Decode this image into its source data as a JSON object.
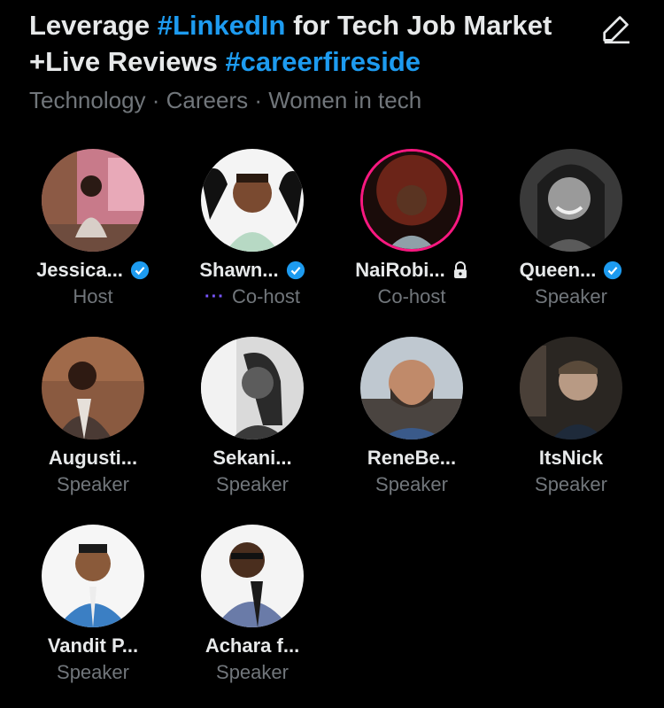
{
  "space": {
    "title_parts": [
      {
        "text": "Leverage ",
        "type": "text"
      },
      {
        "text": "#LinkedIn",
        "type": "hashtag"
      },
      {
        "text": " for Tech Job Market +Live Reviews ",
        "type": "text"
      },
      {
        "text": "#careerfireside",
        "type": "hashtag"
      }
    ],
    "topics": "Technology · Careers · Women in tech",
    "edit_icon": "pencil-icon"
  },
  "colors": {
    "background": "#000000",
    "primary_text": "#E7E9EA",
    "secondary_text": "#71767B",
    "hashtag": "#1D9BF0",
    "verified": "#1D9BF0",
    "live_ring": "#F91880",
    "speaking_dots": "#7856FF"
  },
  "participants": [
    {
      "name": "Jessica...",
      "role": "Host",
      "verified": true,
      "locked": false,
      "speaking": false
    },
    {
      "name": "Shawn...",
      "role": "Co-host",
      "verified": true,
      "locked": false,
      "speaking": true
    },
    {
      "name": "NaiRobi...",
      "role": "Co-host",
      "verified": false,
      "locked": true,
      "speaking": false
    },
    {
      "name": "Queen...",
      "role": "Speaker",
      "verified": true,
      "locked": false,
      "speaking": false
    },
    {
      "name": "Augusti...",
      "role": "Speaker",
      "verified": false,
      "locked": false,
      "speaking": false
    },
    {
      "name": "Sekani...",
      "role": "Speaker",
      "verified": false,
      "locked": false,
      "speaking": false
    },
    {
      "name": "ReneBe...",
      "role": "Speaker",
      "verified": false,
      "locked": false,
      "speaking": false
    },
    {
      "name": "ItsNick",
      "role": "Speaker",
      "verified": false,
      "locked": false,
      "speaking": false
    },
    {
      "name": "Vandit P...",
      "role": "Speaker",
      "verified": false,
      "locked": false,
      "speaking": false
    },
    {
      "name": "Achara f...",
      "role": "Speaker",
      "verified": false,
      "locked": false,
      "speaking": false
    }
  ],
  "speaking_indicator": "···"
}
